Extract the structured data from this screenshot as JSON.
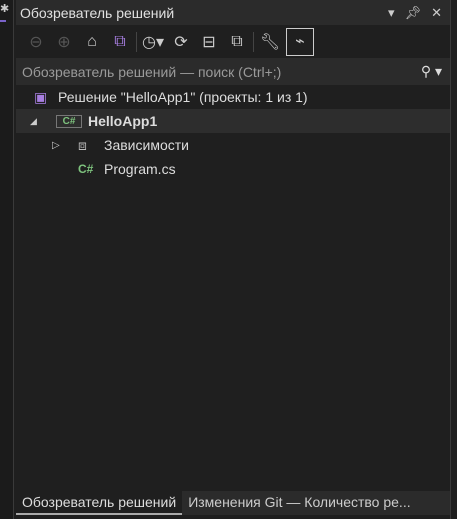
{
  "title": "Обозреватель решений",
  "search_placeholder": "Обозреватель решений — поиск (Ctrl+;)",
  "tree": {
    "solution": "Решение \"HelloApp1\" (проекты: 1 из 1)",
    "project": "HelloApp1",
    "deps": "Зависимости",
    "file": "Program.cs"
  },
  "tabs": [
    "Обозреватель решений",
    "Изменения Git — Количество ре..."
  ],
  "icons": {
    "csharp": "C#"
  }
}
